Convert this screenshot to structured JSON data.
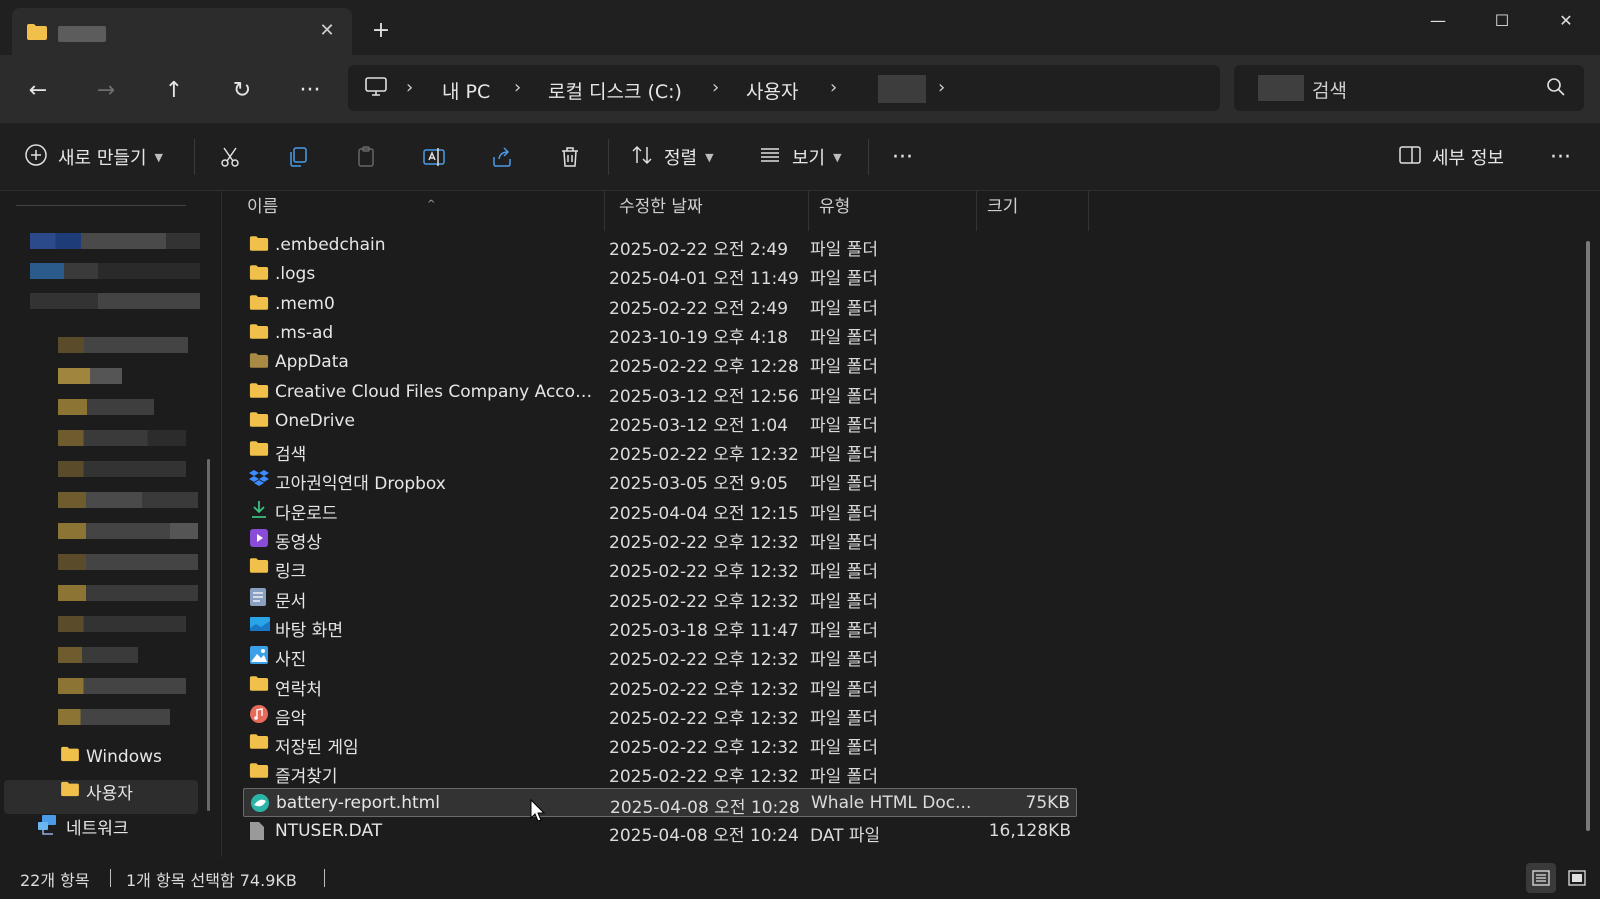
{
  "tab": {
    "close_label": "✕",
    "new_label": "+"
  },
  "window": {
    "minimize": "—",
    "maximize": "☐",
    "close": "✕"
  },
  "nav": {
    "breadcrumb": [
      "내 PC",
      "로컬 디스크 (C:)",
      "사용자"
    ],
    "search_placeholder": "검색"
  },
  "toolbar": {
    "new_label": "새로 만들기",
    "sort_label": "정렬",
    "view_label": "보기",
    "details_label": "세부 정보",
    "more_label": "···"
  },
  "sidebar": {
    "items": [
      {
        "label": "Windows",
        "icon": "folder-icon"
      },
      {
        "label": "사용자",
        "icon": "folder-icon"
      },
      {
        "label": "네트워크",
        "icon": "network-icon"
      }
    ]
  },
  "columns": {
    "name": "이름",
    "date": "수정한 날짜",
    "type": "유형",
    "size": "크기"
  },
  "files": [
    {
      "name": ".embedchain",
      "date": "2025-02-22 오전 2:49",
      "type": "파일 폴더",
      "size": "",
      "icon": "folder"
    },
    {
      "name": ".logs",
      "date": "2025-04-01 오전 11:49",
      "type": "파일 폴더",
      "size": "",
      "icon": "folder"
    },
    {
      "name": ".mem0",
      "date": "2025-02-22 오전 2:49",
      "type": "파일 폴더",
      "size": "",
      "icon": "folder"
    },
    {
      "name": ".ms-ad",
      "date": "2023-10-19 오후 4:18",
      "type": "파일 폴더",
      "size": "",
      "icon": "folder"
    },
    {
      "name": "AppData",
      "date": "2025-02-22 오후 12:28",
      "type": "파일 폴더",
      "size": "",
      "icon": "folder-dim"
    },
    {
      "name": "Creative Cloud Files Company Account...",
      "date": "2025-03-12 오전 12:56",
      "type": "파일 폴더",
      "size": "",
      "icon": "folder"
    },
    {
      "name": "OneDrive",
      "date": "2025-03-12 오전 1:04",
      "type": "파일 폴더",
      "size": "",
      "icon": "folder"
    },
    {
      "name": "검색",
      "date": "2025-02-22 오후 12:32",
      "type": "파일 폴더",
      "size": "",
      "icon": "folder"
    },
    {
      "name": "고아권익연대 Dropbox",
      "date": "2025-03-05 오전 9:05",
      "type": "파일 폴더",
      "size": "",
      "icon": "dropbox"
    },
    {
      "name": "다운로드",
      "date": "2025-04-04 오전 12:15",
      "type": "파일 폴더",
      "size": "",
      "icon": "download"
    },
    {
      "name": "동영상",
      "date": "2025-02-22 오후 12:32",
      "type": "파일 폴더",
      "size": "",
      "icon": "video"
    },
    {
      "name": "링크",
      "date": "2025-02-22 오후 12:32",
      "type": "파일 폴더",
      "size": "",
      "icon": "folder"
    },
    {
      "name": "문서",
      "date": "2025-02-22 오후 12:32",
      "type": "파일 폴더",
      "size": "",
      "icon": "document"
    },
    {
      "name": "바탕 화면",
      "date": "2025-03-18 오후 11:47",
      "type": "파일 폴더",
      "size": "",
      "icon": "desktop"
    },
    {
      "name": "사진",
      "date": "2025-02-22 오후 12:32",
      "type": "파일 폴더",
      "size": "",
      "icon": "picture"
    },
    {
      "name": "연락처",
      "date": "2025-02-22 오후 12:32",
      "type": "파일 폴더",
      "size": "",
      "icon": "folder"
    },
    {
      "name": "음악",
      "date": "2025-02-22 오후 12:32",
      "type": "파일 폴더",
      "size": "",
      "icon": "music"
    },
    {
      "name": "저장된 게임",
      "date": "2025-02-22 오후 12:32",
      "type": "파일 폴더",
      "size": "",
      "icon": "folder"
    },
    {
      "name": "즐겨찾기",
      "date": "2025-02-22 오후 12:32",
      "type": "파일 폴더",
      "size": "",
      "icon": "folder"
    },
    {
      "name": "battery-report.html",
      "date": "2025-04-08 오전 10:28",
      "type": "Whale HTML Doc...",
      "size": "75KB",
      "icon": "whale",
      "selected": true
    },
    {
      "name": "NTUSER.DAT",
      "date": "2025-04-08 오전 10:24",
      "type": "DAT 파일",
      "size": "16,128KB",
      "icon": "file"
    }
  ],
  "status": {
    "count": "22개 항목",
    "selection": "1개 항목 선택함 74.9KB"
  },
  "colors": {
    "folder": "#f0c04a",
    "accent": "#4c9be8",
    "background": "#1c1c1c"
  }
}
